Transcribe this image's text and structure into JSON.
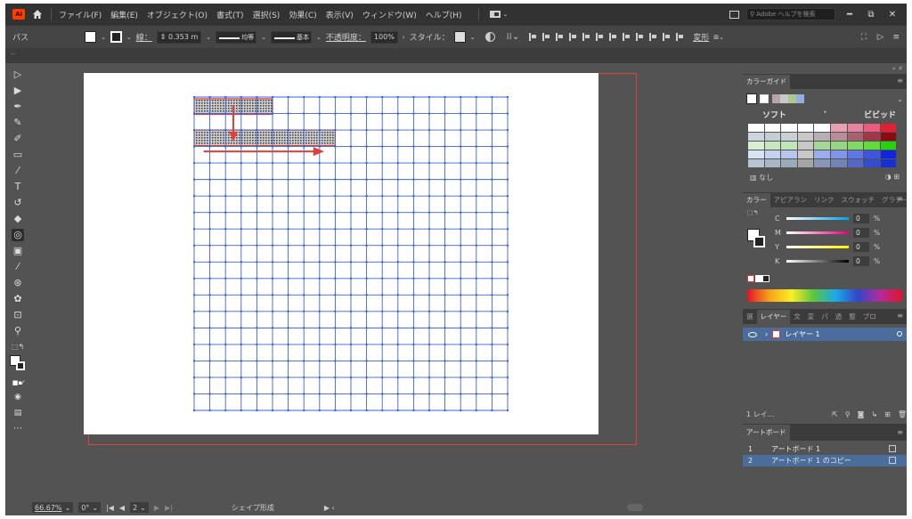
{
  "menubar": {
    "logo": "Ai",
    "items": [
      "ファイル(F)",
      "編集(E)",
      "オブジェクト(O)",
      "書式(T)",
      "選択(S)",
      "効果(C)",
      "表示(V)",
      "ウィンドウ(W)",
      "ヘルプ(H)"
    ],
    "search_placeholder": "Adobe ヘルプを検索",
    "window_buttons": [
      "━",
      "⧉",
      "✕"
    ]
  },
  "controlbar": {
    "selection_label": "パス",
    "stroke_label": "線：",
    "stroke_value": "0.353 m",
    "profile_label": "均等",
    "brush_label": "基本",
    "opacity_label": "不透明度：",
    "opacity_value": "100%",
    "style_label": "スタイル：",
    "transform_label": "変形"
  },
  "panels": {
    "color_guide": {
      "tab": "カラーガイド",
      "soft_label": "ソフト",
      "vivid_label": "ビビッド",
      "none_label": "なし",
      "harmony_strip": [
        "#b8a3a8",
        "#c8c8c8",
        "#a9c98f",
        "#93aee2"
      ],
      "grid": [
        [
          "#ffffff",
          "#ffffff",
          "#ffffff",
          "#ffffff",
          "#ffffff",
          "#e79fb2",
          "#e584a0",
          "#ea5b7d",
          "#e22034"
        ],
        [
          "#cfd3dd",
          "#c3cdd6",
          "#c8cfd5",
          "#c8c8c8",
          "#b6b0b4",
          "#b58e98",
          "#a8616f",
          "#a0384a",
          "#8b0b12"
        ],
        [
          "#d9eed4",
          "#c9e6c2",
          "#c0e5b6",
          "#c8c8c8",
          "#a6d895",
          "#96d77f",
          "#7ddb61",
          "#5fdc3a",
          "#25d40b"
        ],
        [
          "#d8e3f4",
          "#c5d3f0",
          "#b6c6ee",
          "#c8c8c8",
          "#9aaeee",
          "#7e95ea",
          "#5f77e4",
          "#3c56df",
          "#1124dc"
        ],
        [
          "#b8c4d1",
          "#a8b6c5",
          "#9aaab9",
          "#a5a5a5",
          "#8996b4",
          "#7283b6",
          "#5568c4",
          "#364ccf",
          "#1630d6"
        ]
      ]
    },
    "color": {
      "tabs": [
        "カラー",
        "アピアラン",
        "リンク",
        "スウォッチ",
        "グラデーシ"
      ],
      "channels": [
        {
          "label": "C",
          "value": "0",
          "unit": "%",
          "gradient": "linear-gradient(90deg,#ffffff,#00a0e9)"
        },
        {
          "label": "M",
          "value": "0",
          "unit": "%",
          "gradient": "linear-gradient(90deg,#ffffff,#e4007f)"
        },
        {
          "label": "Y",
          "value": "0",
          "unit": "%",
          "gradient": "linear-gradient(90deg,#ffffff,#fff100)"
        },
        {
          "label": "K",
          "value": "0",
          "unit": "%",
          "gradient": "linear-gradient(90deg,#ffffff,#000000)"
        }
      ]
    },
    "layers": {
      "tabs": [
        "選",
        "レイヤー",
        "文",
        "変",
        "パ",
        "透",
        "整",
        "プロ"
      ],
      "layer_name": "レイヤー 1",
      "count_label": "1 レイ…"
    },
    "artboards": {
      "tab": "アートボード",
      "items": [
        {
          "num": "1",
          "name": "アートボード 1"
        },
        {
          "num": "2",
          "name": "アートボード 1 のコピー"
        }
      ]
    }
  },
  "statusbar": {
    "zoom": "66.67%",
    "rotation": "0°",
    "artboard_number": "2",
    "tool_status": "シェイプ形成"
  },
  "canvas": {
    "grid_cols": 20,
    "grid_rows": 19,
    "highlight_color": "#e0403a",
    "grid_color": "#3b63d6"
  }
}
